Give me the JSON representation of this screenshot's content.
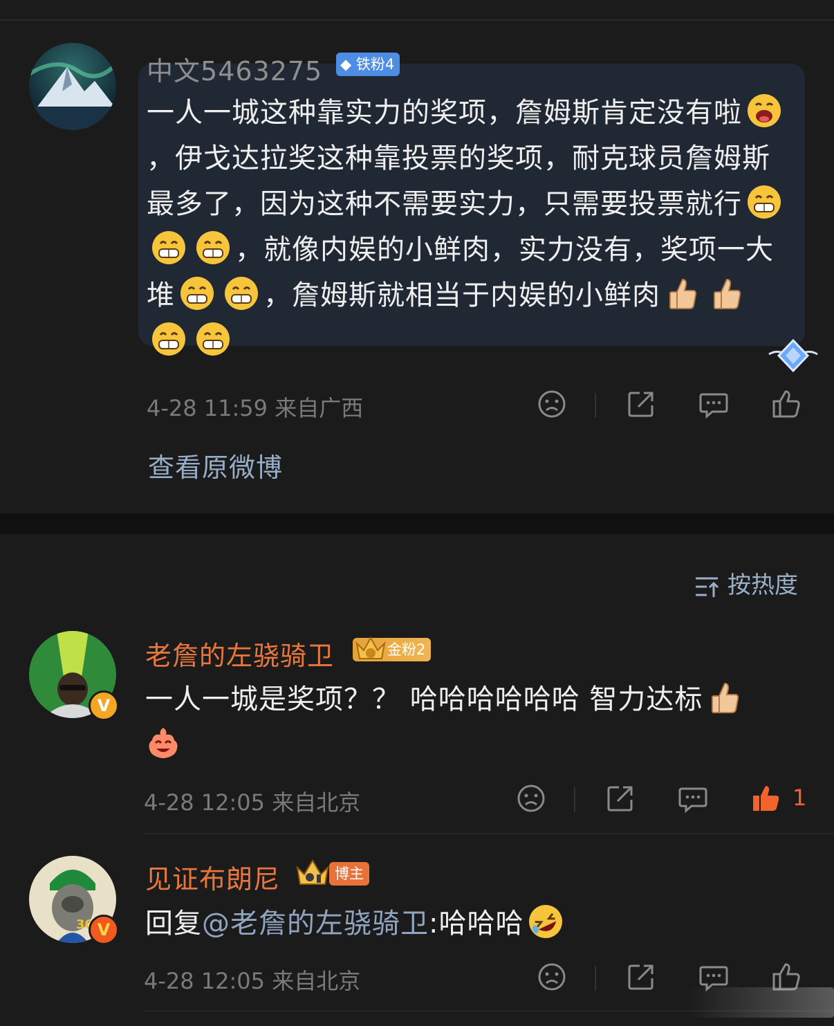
{
  "post": {
    "username": "中文5463275",
    "fan_badge": "铁粉4",
    "text_segments": [
      "一人一城这种靠实力的奖项，詹姆斯肯定没有啦",
      "，伊戈达拉奖这种靠投票的奖项，耐克球员詹姆斯最多了，因为这种不需要实力，只需要投票就行",
      "，就像内娱的小鲜肉，实力没有，奖项一大堆",
      "，詹姆斯就相当于内娱的小鲜肉"
    ],
    "time": "4-28 11:59",
    "location": "来自广西",
    "view_original": "查看原微博"
  },
  "sort": {
    "label": "按热度"
  },
  "comments": [
    {
      "username": "老詹的左骁骑卫",
      "fan_badge": "金粉2",
      "text": "一人一城是奖项？？ 哈哈哈哈哈哈 智力达标",
      "time": "4-28 12:05",
      "location": "来自北京",
      "like_count": "1",
      "verified": "V"
    },
    {
      "username": "见证布朗尼",
      "role_badge": "博主",
      "reply_prefix": "回复",
      "mention": "@老詹的左骁骑卫",
      "reply_text": ":哈哈哈",
      "time": "4-28 12:05",
      "location": "来自北京",
      "jersey_number": "30",
      "verified": "V"
    }
  ],
  "icons": [
    "dislike-icon",
    "share-icon",
    "comment-icon",
    "like-icon",
    "sort-icon",
    "thumbs-up-emoji",
    "grin-emoji",
    "laugh-emoji",
    "rofl-emoji"
  ],
  "colors": {
    "accent_orange": "#e8773d",
    "link_blue": "#98aec8",
    "like_active": "#f2642b",
    "bubble": "#202833"
  }
}
